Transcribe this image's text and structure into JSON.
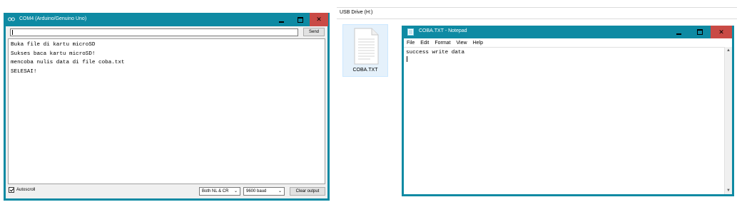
{
  "serial_monitor": {
    "title": "COM4 (Arduino/Genuino Uno)",
    "input_value": "",
    "send_label": "Send",
    "output_lines": [
      "Buka file di kartu microSD",
      "Sukses baca kartu microSD!",
      "mencoba nulis data di file coba.txt",
      "SELESAI!"
    ],
    "autoscroll_label": "Autoscroll",
    "autoscroll_checked": true,
    "line_ending": "Both NL & CR",
    "baud_rate": "9600 baud",
    "clear_label": "Clear output",
    "icon": "arduino-icon"
  },
  "explorer": {
    "location": "USB Drive (H:)",
    "file_name": "COBA.TXT",
    "file_icon": "text-document-icon"
  },
  "notepad": {
    "title": "COBA.TXT - Notepad",
    "menu": [
      "File",
      "Edit",
      "Format",
      "View",
      "Help"
    ],
    "content_lines": [
      "success write data",
      ""
    ],
    "icon": "notepad-icon"
  },
  "window_controls": {
    "minimize": "minimize-icon",
    "maximize": "maximize-icon",
    "close": "close-icon"
  },
  "colors": {
    "title_bar": "#0e8aa3",
    "close_button": "#c94a45",
    "client_bg": "#f0f0f0",
    "selection_tile": "#e5f1fb"
  }
}
